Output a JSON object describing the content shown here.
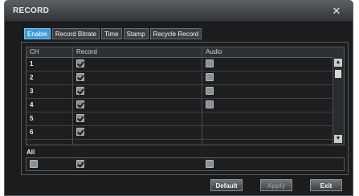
{
  "window": {
    "title": "RECORD",
    "close_glyph": "✕"
  },
  "tabs": [
    {
      "label": "Enable",
      "active": true
    },
    {
      "label": "Record Bitrate",
      "active": false
    },
    {
      "label": "Time",
      "active": false
    },
    {
      "label": "Stamp",
      "active": false
    },
    {
      "label": "Recycle Record",
      "active": false
    }
  ],
  "table": {
    "headers": {
      "ch": "CH",
      "record": "Record",
      "audio": "Audio"
    },
    "rows": [
      {
        "ch": "1",
        "record": true,
        "audio": false
      },
      {
        "ch": "2",
        "record": true,
        "audio": false
      },
      {
        "ch": "3",
        "record": true,
        "audio": false
      },
      {
        "ch": "4",
        "record": true,
        "audio": false
      },
      {
        "ch": "5",
        "record": true,
        "audio": null
      },
      {
        "ch": "6",
        "record": true,
        "audio": null
      }
    ]
  },
  "all": {
    "label": "All",
    "select": false,
    "record": true,
    "audio": false
  },
  "buttons": {
    "default": "Default",
    "apply": "Apply",
    "exit": "Exit"
  },
  "colors": {
    "active_tab": "#3f9ad9",
    "window_bg": "#1a1c1e"
  }
}
